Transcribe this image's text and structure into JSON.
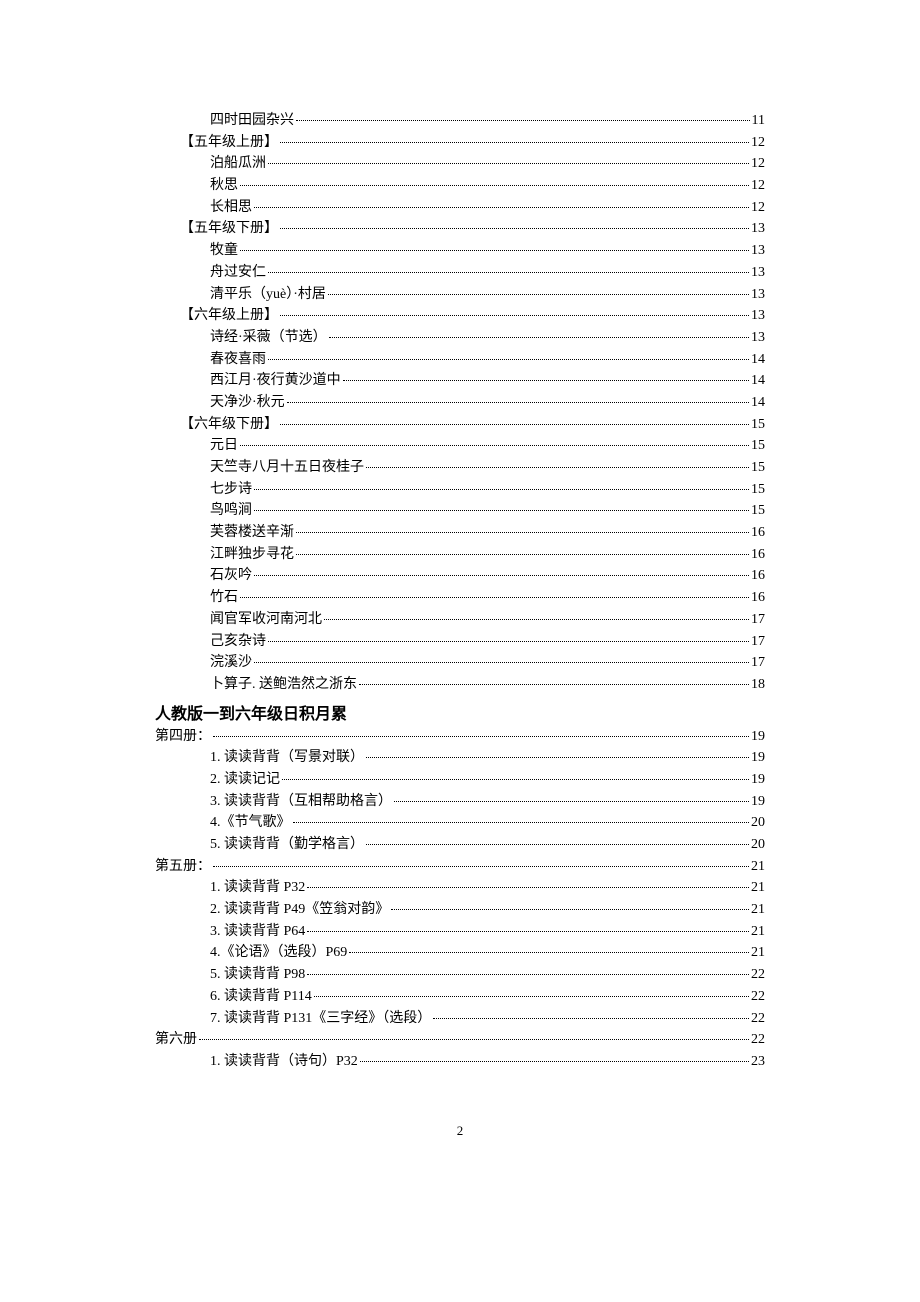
{
  "toc": [
    {
      "level": 2,
      "title": "四时田园杂兴",
      "page": "11"
    },
    {
      "level": 1,
      "title": "【五年级上册】",
      "page": "12"
    },
    {
      "level": 2,
      "title": "泊船瓜洲",
      "page": "12"
    },
    {
      "level": 2,
      "title": "秋思",
      "page": "12"
    },
    {
      "level": 2,
      "title": "长相思",
      "page": "12"
    },
    {
      "level": 1,
      "title": "【五年级下册】",
      "page": "13"
    },
    {
      "level": 2,
      "title": "牧童",
      "page": "13"
    },
    {
      "level": 2,
      "title": "舟过安仁",
      "page": "13"
    },
    {
      "level": 2,
      "title": "清平乐（yuè）·村居",
      "page": "13"
    },
    {
      "level": 1,
      "title": "【六年级上册】",
      "page": "13"
    },
    {
      "level": 2,
      "title": "诗经·采薇（节选）",
      "page": "13"
    },
    {
      "level": 2,
      "title": "春夜喜雨",
      "page": "14"
    },
    {
      "level": 2,
      "title": "西江月·夜行黄沙道中",
      "page": "14"
    },
    {
      "level": 2,
      "title": "天净沙·秋元",
      "page": "14"
    },
    {
      "level": 1,
      "title": "【六年级下册】",
      "page": "15"
    },
    {
      "level": 2,
      "title": "元日",
      "page": "15"
    },
    {
      "level": 2,
      "title": "天竺寺八月十五日夜桂子",
      "page": "15"
    },
    {
      "level": 2,
      "title": "七步诗",
      "page": "15"
    },
    {
      "level": 2,
      "title": "鸟鸣涧",
      "page": "15"
    },
    {
      "level": 2,
      "title": "芙蓉楼送辛渐",
      "page": "16"
    },
    {
      "level": 2,
      "title": "江畔独步寻花",
      "page": "16"
    },
    {
      "level": 2,
      "title": "石灰吟",
      "page": "16"
    },
    {
      "level": 2,
      "title": "竹石",
      "page": "16"
    },
    {
      "level": 2,
      "title": "闻官军收河南河北",
      "page": "17"
    },
    {
      "level": 2,
      "title": "己亥杂诗",
      "page": "17"
    },
    {
      "level": 2,
      "title": "浣溪沙",
      "page": "17"
    },
    {
      "level": 2,
      "title": "卜算子. 送鲍浩然之浙东",
      "page": "18"
    }
  ],
  "section_heading": "人教版一到六年级日积月累",
  "toc2": [
    {
      "level": 0,
      "title": "第四册：",
      "page": "19"
    },
    {
      "level": 2,
      "title": "1. 读读背背（写景对联）",
      "page": "19"
    },
    {
      "level": 2,
      "title": "2. 读读记记",
      "page": "19"
    },
    {
      "level": 2,
      "title": "3. 读读背背（互相帮助格言）",
      "page": "19"
    },
    {
      "level": 2,
      "title": "4.《节气歌》",
      "page": "20"
    },
    {
      "level": 2,
      "title": "5. 读读背背（勤学格言）",
      "page": "20"
    },
    {
      "level": 0,
      "title": "第五册：",
      "page": "21"
    },
    {
      "level": 2,
      "title": "1. 读读背背 P32",
      "page": "21"
    },
    {
      "level": 2,
      "title": "2. 读读背背 P49《笠翁对韵》",
      "page": "21"
    },
    {
      "level": 2,
      "title": "3. 读读背背 P64",
      "page": "21"
    },
    {
      "level": 2,
      "title": "4.《论语》（选段）P69",
      "page": "21"
    },
    {
      "level": 2,
      "title": "5. 读读背背 P98",
      "page": "22"
    },
    {
      "level": 2,
      "title": "6. 读读背背 P114",
      "page": "22"
    },
    {
      "level": 2,
      "title": "7. 读读背背 P131《三字经》（选段）",
      "page": "22"
    },
    {
      "level": 0,
      "title": "第六册",
      "page": "22"
    },
    {
      "level": 2,
      "title": "1. 读读背背（诗句）P32",
      "page": "23"
    }
  ],
  "page_number": "2"
}
